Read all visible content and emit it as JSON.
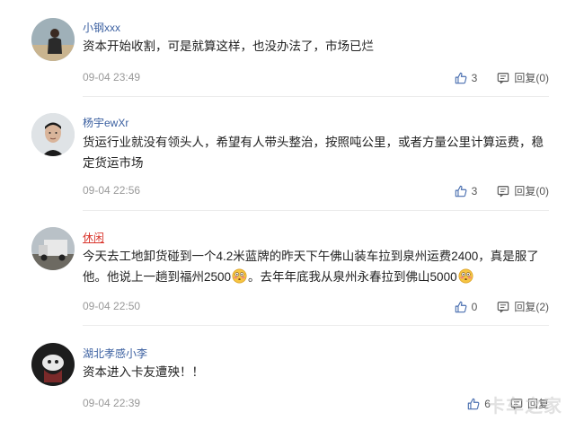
{
  "comments": [
    {
      "username": "小钢xxx",
      "text": "资本开始收割，可是就算这样，也没办法了，市场已烂",
      "time": "09-04 23:49",
      "likes": "3",
      "reply_label": "回复(0)"
    },
    {
      "username": "杨宇ewXr",
      "text": "货运行业就没有领头人，希望有人带头整治，按照吨公里，或者方量公里计算运费，稳定货运市场",
      "time": "09-04 22:56",
      "likes": "3",
      "reply_label": "回复(0)"
    },
    {
      "username": "休闲",
      "text_part1": "今天去工地卸货碰到一个4.2米蓝牌的昨天下午佛山装车拉到泉州运费2400，真是服了他。他说上一趟到福州2500",
      "text_part2": "。去年年底我从泉州永春拉到佛山5000",
      "time": "09-04 22:50",
      "likes": "0",
      "reply_label": "回复(2)"
    },
    {
      "username": "湖北孝感小李",
      "text": "资本进入卡友遭殃！！",
      "time": "09-04 22:39",
      "likes": "6",
      "reply_label": "回复"
    }
  ],
  "watermark": "卡车之家",
  "colors": {
    "username": "#3a5fa0",
    "username_highlight": "#d9342b",
    "time": "#999999"
  }
}
